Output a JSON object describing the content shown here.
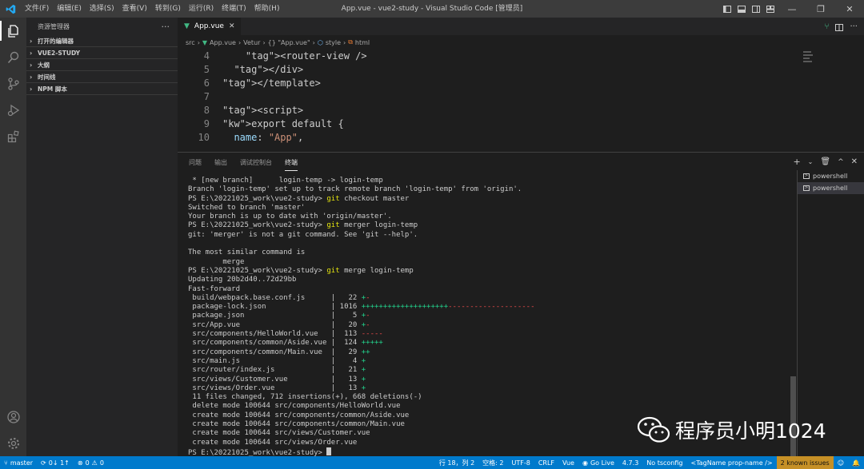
{
  "titlebar": {
    "menu": [
      "文件(F)",
      "编辑(E)",
      "选择(S)",
      "查看(V)",
      "转到(G)",
      "运行(R)",
      "终端(T)",
      "帮助(H)"
    ],
    "title": "App.vue - vue2-study - Visual Studio Code [管理员]"
  },
  "sidebar": {
    "header": "资源管理器",
    "sections": [
      "打开的编辑器",
      "VUE2-STUDY",
      "大纲",
      "时间线",
      "NPM 脚本"
    ]
  },
  "editor": {
    "tab": "App.vue",
    "breadcrumb": [
      "src",
      "App.vue",
      "Vetur",
      "{} \"App.vue\"",
      "style",
      "html"
    ],
    "lines": [
      {
        "n": "4",
        "code": "    <router-view />"
      },
      {
        "n": "5",
        "code": "  </div>"
      },
      {
        "n": "6",
        "code": "</template>"
      },
      {
        "n": "7",
        "code": ""
      },
      {
        "n": "8",
        "code": "<script>"
      },
      {
        "n": "9",
        "code": "export default {"
      },
      {
        "n": "10",
        "code": "  name: \"App\","
      }
    ]
  },
  "panel": {
    "tabs": [
      "问题",
      "输出",
      "调试控制台",
      "终端"
    ],
    "terminals": [
      "powershell",
      "powershell"
    ],
    "term_lines": [
      {
        "t": " * [new branch]      login-temp -> login-temp"
      },
      {
        "t": "Branch 'login-temp' set up to track remote branch 'login-temp' from 'origin'."
      },
      {
        "p": "PS E:\\20221025_work\\vue2-study> ",
        "c": "git",
        "r": " checkout master"
      },
      {
        "t": "Switched to branch 'master'"
      },
      {
        "t": "Your branch is up to date with 'origin/master'."
      },
      {
        "p": "PS E:\\20221025_work\\vue2-study> ",
        "c": "git",
        "r": " merger login-temp"
      },
      {
        "t": "git: 'merger' is not a git command. See 'git --help'."
      },
      {
        "t": ""
      },
      {
        "t": "The most similar command is"
      },
      {
        "t": "        merge"
      },
      {
        "p": "PS E:\\20221025_work\\vue2-study> ",
        "c": "git",
        "r": " merge login-temp"
      },
      {
        "t": "Updating 20b2d40..72d29bb"
      },
      {
        "t": "Fast-forward"
      },
      {
        "f": " build/webpack.base.conf.js      |   22 ",
        "plus": "+",
        "minus": "-"
      },
      {
        "f": " package-lock.json               | 1016 ",
        "plus": "++++++++++++++++++++",
        "minus": "--------------------"
      },
      {
        "f": " package.json                    |    5 ",
        "plus": "+",
        "minus": "-"
      },
      {
        "f": " src/App.vue                     |   20 ",
        "plus": "+",
        "minus": "-"
      },
      {
        "f": " src/components/HelloWorld.vue   |  113 ",
        "plus": "",
        "minus": "-----"
      },
      {
        "f": " src/components/common/Aside.vue |  124 ",
        "plus": "+++++",
        "minus": ""
      },
      {
        "f": " src/components/common/Main.vue  |   29 ",
        "plus": "++",
        "minus": ""
      },
      {
        "f": " src/main.js                     |    4 ",
        "plus": "+",
        "minus": ""
      },
      {
        "f": " src/router/index.js             |   21 ",
        "plus": "+",
        "minus": ""
      },
      {
        "f": " src/views/Customer.vue          |   13 ",
        "plus": "+",
        "minus": ""
      },
      {
        "f": " src/views/Order.vue             |   13 ",
        "plus": "+",
        "minus": ""
      },
      {
        "t": " 11 files changed, 712 insertions(+), 668 deletions(-)"
      },
      {
        "t": " delete mode 100644 src/components/HelloWorld.vue"
      },
      {
        "t": " create mode 100644 src/components/common/Aside.vue"
      },
      {
        "t": " create mode 100644 src/components/common/Main.vue"
      },
      {
        "t": " create mode 100644 src/views/Customer.vue"
      },
      {
        "t": " create mode 100644 src/views/Order.vue"
      },
      {
        "p": "PS E:\\20221025_work\\vue2-study> ",
        "c": "",
        "r": "",
        "cursor": true
      }
    ]
  },
  "watermark": "程序员小明1024",
  "status": {
    "branch": "master",
    "sync": "0↓ 1↑",
    "errors": "0",
    "warnings": "0",
    "position": "行 18，列 2",
    "spaces": "空格: 2",
    "encoding": "UTF-8",
    "eol": "CRLF",
    "language": "Vue",
    "golive": "Go Live",
    "version": "4.7.3",
    "tsconfig": "No tsconfig",
    "tagname": "<TagName prop-name />",
    "issues": "2 known issues"
  }
}
